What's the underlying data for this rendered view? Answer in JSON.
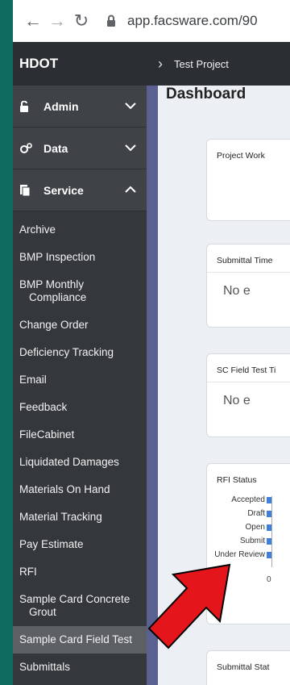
{
  "browser": {
    "url": "app.facsware.com/90"
  },
  "header": {
    "brand": "HDOT",
    "breadcrumb": "Test Project"
  },
  "sidebar": {
    "groups": [
      {
        "label": "Admin"
      },
      {
        "label": "Data"
      },
      {
        "label": "Service"
      }
    ],
    "items": [
      "Archive",
      "BMP Inspection",
      "BMP Monthly",
      "Compliance",
      "Change Order",
      "Deficiency Tracking",
      "Email",
      "Feedback",
      "FileCabinet",
      "Liquidated Damages",
      "Materials On Hand",
      "Material Tracking",
      "Pay Estimate",
      "RFI",
      "Sample Card Concrete",
      "Grout",
      "Sample Card Field Test",
      "Submittals"
    ]
  },
  "main": {
    "title": "Dashboard",
    "cards": [
      {
        "title": "Project Work",
        "empty": ""
      },
      {
        "title": "Submittal Time",
        "empty": "No e"
      },
      {
        "title": "SC Field Test Ti",
        "empty": "No e"
      },
      {
        "title": "RFI Status"
      },
      {
        "title": "Submittal Stat"
      }
    ],
    "rfi": {
      "rows": [
        "Accepted",
        "Draft",
        "Open",
        "Submit",
        "Under Review"
      ],
      "zero": "0"
    }
  },
  "colors": {
    "accent_bar": "#3f7fe0",
    "arrow_fill": "#e4161b"
  }
}
